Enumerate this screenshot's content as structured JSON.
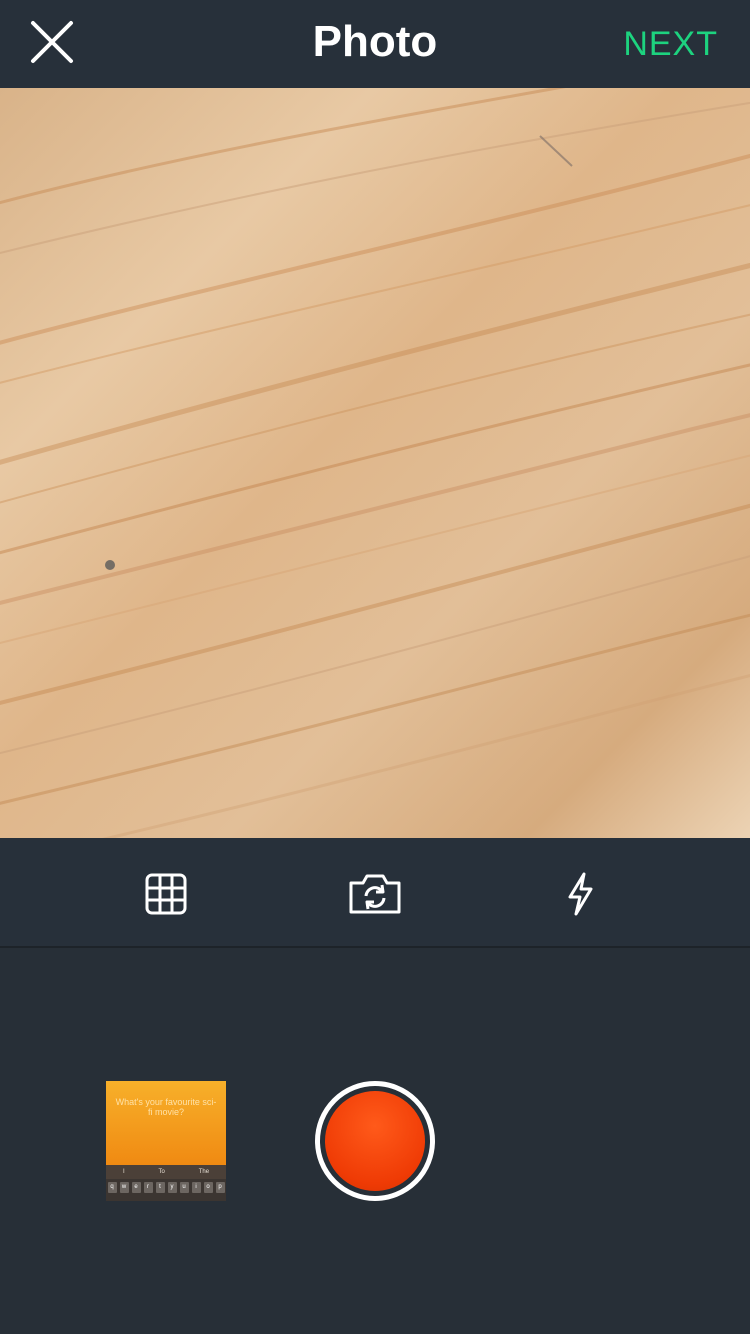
{
  "header": {
    "title": "Photo",
    "close_icon": "close-icon",
    "next_label": "NEXT"
  },
  "colors": {
    "background": "#272f37",
    "accent": "#1dd37f",
    "shutter": "#f2430b"
  },
  "toolbar": {
    "items": [
      {
        "icon": "grid-icon"
      },
      {
        "icon": "switch-camera-icon"
      },
      {
        "icon": "flash-icon"
      }
    ]
  },
  "gallery_thumbnail": {
    "question": "What's your favourite sci-fi movie?",
    "suggestions": [
      "I",
      "To",
      "The"
    ],
    "keys": [
      "q",
      "w",
      "e",
      "r",
      "t",
      "y",
      "u",
      "i",
      "o",
      "p"
    ]
  }
}
